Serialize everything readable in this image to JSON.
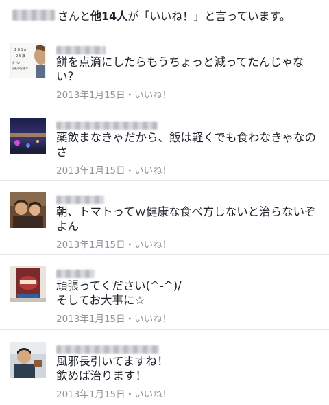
{
  "header": {
    "text_mid": "さんと",
    "text_strong": "他14人",
    "text_tail": "が「いいね！」と言っています。"
  },
  "comments": [
    {
      "text": "餅を点滴にしたらもうちょっと減ってたんじゃない？",
      "date": "2013年1月15日",
      "sep": "・",
      "like": "いいね！"
    },
    {
      "text": "薬飲まなきゃだから、飯は軽くでも食わなきゃなのさ",
      "date": "2013年1月15日",
      "sep": "・",
      "like": "いいね！"
    },
    {
      "text": "朝、トマトってｗ健康な食べ方しないと治らないぞよん",
      "date": "2013年1月15日",
      "sep": "・",
      "like": "いいね！"
    },
    {
      "text": "頑張ってください(^-^)/\nそしてお大事に☆",
      "date": "2013年1月15日",
      "sep": "・",
      "like": "いいね！"
    },
    {
      "text": "風邪長引いてますね！\n飲めば治ります！",
      "date": "2013年1月15日",
      "sep": "・",
      "like": "いいね！"
    }
  ],
  "avatar1": {
    "line1": "１８２ｍ",
    "line2": "２５歳",
    "line3": "ﾀﾞｻい",
    "line4": "自転車好きで"
  }
}
